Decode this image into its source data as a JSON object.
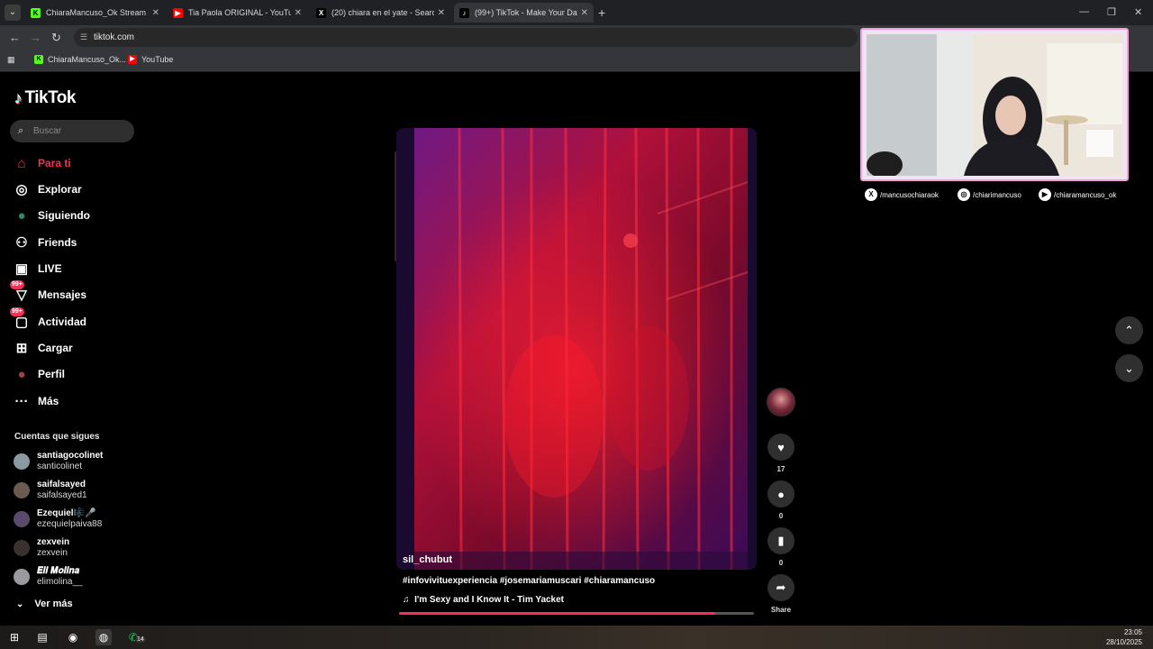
{
  "browser": {
    "tabs": [
      {
        "title": "ChiaraMancuso_Ok Stream - W",
        "fav": "K",
        "fav_color": "#53fc18",
        "active": false
      },
      {
        "title": "Tia Paola ORIGINAL - YouTube",
        "fav": "▶",
        "fav_color": "#ff0000",
        "active": false
      },
      {
        "title": "(20) chiara en el yate - Search /",
        "fav": "X",
        "fav_color": "#000000",
        "active": false
      },
      {
        "title": "(99+) TikTok - Make Your Day",
        "fav": "♪",
        "fav_color": "#000000",
        "active": true
      }
    ],
    "url": "tiktok.com",
    "bookmarks": [
      {
        "label": "ChiaraMancuso_Ok...",
        "fav": "K",
        "fav_color": "#53fc18"
      },
      {
        "label": "YouTube",
        "fav": "▶",
        "fav_color": "#ff0000"
      }
    ]
  },
  "tiktok": {
    "logo_text": "TikTok",
    "search_placeholder": "Buscar",
    "nav": [
      {
        "label": "Para ti",
        "icon": "home-icon",
        "glyph": "⌂",
        "active": true,
        "badge": ""
      },
      {
        "label": "Explorar",
        "icon": "compass-icon",
        "glyph": "◎",
        "active": false,
        "badge": ""
      },
      {
        "label": "Siguiendo",
        "icon": "following-avatar-icon",
        "glyph": "●",
        "active": false,
        "badge": ""
      },
      {
        "label": "Friends",
        "icon": "friends-icon",
        "glyph": "⚇",
        "active": false,
        "badge": ""
      },
      {
        "label": "LIVE",
        "icon": "live-tv-icon",
        "glyph": "▣",
        "active": false,
        "badge": ""
      },
      {
        "label": "Mensajes",
        "icon": "messages-icon",
        "glyph": "▽",
        "active": false,
        "badge": "99+"
      },
      {
        "label": "Actividad",
        "icon": "activity-icon",
        "glyph": "▢",
        "active": false,
        "badge": "99+"
      },
      {
        "label": "Cargar",
        "icon": "upload-icon",
        "glyph": "⊞",
        "active": false,
        "badge": ""
      },
      {
        "label": "Perfil",
        "icon": "profile-avatar-icon",
        "glyph": "●",
        "active": false,
        "badge": ""
      },
      {
        "label": "Más",
        "icon": "more-icon",
        "glyph": "···",
        "active": false,
        "badge": ""
      }
    ],
    "following_heading": "Cuentas que sigues",
    "accounts": [
      {
        "name": "santiagocolinet",
        "user": "santicolinet",
        "color": "#8a9aa0"
      },
      {
        "name": "saifalsayed",
        "user": "saifalsayed1",
        "color": "#6a5a50"
      },
      {
        "name": "Ezequiel🎼🎤",
        "user": "ezequielpaiva88",
        "color": "#5a4a6a"
      },
      {
        "name": "zexvein",
        "user": "zexvein",
        "color": "#3a3030"
      },
      {
        "name": "𝑬𝒍𝒊 𝑴𝒐𝒍𝒊𝒏𝒂",
        "user": "elimolina__",
        "color": "#9a9aa0"
      }
    ],
    "see_more": "Ver más",
    "video": {
      "author": "sil_chubut",
      "description": "#infovivituexperiencia #josemariamuscari #chiaramancuso",
      "music": "I'm Sexy and I Know It - Tim Yacket",
      "progress": 0.89
    },
    "actions": {
      "likes": "17",
      "comments": "0",
      "saves": "0",
      "share": "Share"
    }
  },
  "overlay": {
    "socials": [
      {
        "handle": "/mancusochiaraok",
        "icon": "x-logo-icon",
        "glyph": "X"
      },
      {
        "handle": "/chiarimancuso",
        "icon": "instagram-icon",
        "glyph": "◎"
      },
      {
        "handle": "/chiaramancuso_ok",
        "icon": "youtube-icon",
        "glyph": "▶"
      }
    ]
  },
  "taskbar": {
    "time": "23:05",
    "date": "28/10/2025",
    "whatsapp_badge": "14"
  }
}
